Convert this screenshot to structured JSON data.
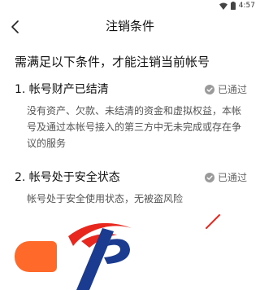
{
  "status_bar": {
    "time": "4:57"
  },
  "header": {
    "title": "注销条件",
    "back_icon": "chevron-left-icon"
  },
  "heading": "需满足以下条件，才能注销当前帐号",
  "conditions": [
    {
      "title": "1. 帐号财产已结清",
      "status": "已通过",
      "description": "没有资产、欠款、未结清的资金和虚拟权益，本帐号及通过本帐号接入的第三方中无未完成或存在争议的服务"
    },
    {
      "title": "2. 帐号处于安全状态",
      "status": "已通过",
      "description": "帐号处于安全使用状态，无被盗风险"
    }
  ],
  "colors": {
    "accent": "#ff6a2b",
    "logo_red": "#e8281f",
    "logo_blue": "#1a3b8f"
  }
}
